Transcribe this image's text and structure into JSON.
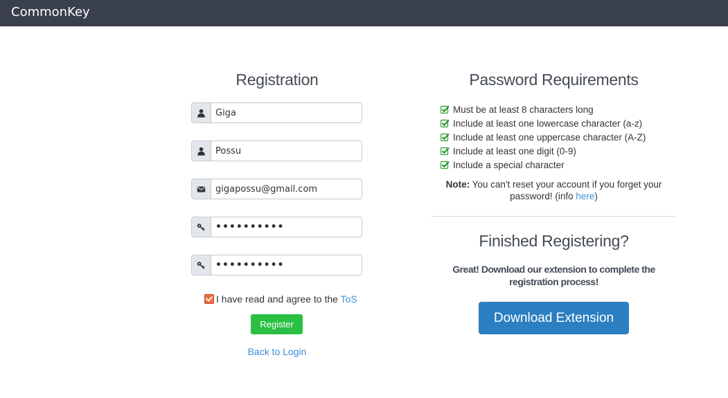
{
  "app": {
    "name": "CommonKey"
  },
  "registration": {
    "title": "Registration",
    "first_name": "Giga",
    "last_name": "Possu",
    "email": "gigapossu@gmail.com",
    "password": "••••••••••",
    "confirm_password": "••••••••••",
    "tos": {
      "checked": true,
      "text": "I have read and agree to the ",
      "link": "ToS"
    },
    "register_label": "Register",
    "back_label": "Back to Login"
  },
  "requirements": {
    "title": "Password Requirements",
    "items": [
      "Must be at least 8 characters long",
      "Include at least one lowercase character (a-z)",
      "Include at least one uppercase character (A-Z)",
      "Include at least one digit (0-9)",
      "Include a special character"
    ],
    "note_label": "Note:",
    "note_text": " You can't reset your account if you forget your password! (info ",
    "note_link": "here",
    "note_end": ")"
  },
  "finished": {
    "title": "Finished Registering?",
    "message": "Great! Download our extension to complete the registration process!",
    "download_label": "Download Extension"
  },
  "colors": {
    "navbar": "#3a3f4e",
    "register_button": "#2bbf44",
    "download_button": "#2c7fc0",
    "link": "#3a8fd6",
    "check": "#2a9a2a"
  },
  "icons": {
    "first_name": "user-icon",
    "last_name": "user-icon",
    "email": "envelope-icon",
    "password": "key-icon",
    "confirm_password": "key-icon",
    "requirement": "checkbox-checked-icon"
  }
}
